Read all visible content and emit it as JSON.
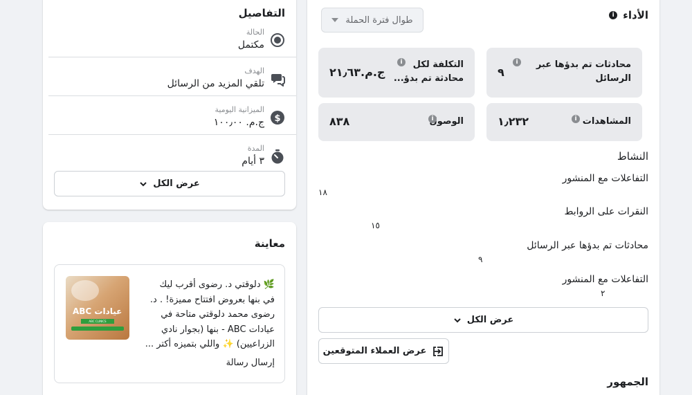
{
  "details": {
    "title": "التفاصيل",
    "rows": [
      {
        "label": "الحالة",
        "value": "مكتمل",
        "icon": "status-icon"
      },
      {
        "label": "الهدف",
        "value": "تلقي المزيد من الرسائل",
        "icon": "message-icon"
      },
      {
        "label": "الميزانية اليومية",
        "value": "ج.م. ١٠٠٫٠٠",
        "icon": "dollar-icon"
      },
      {
        "label": "المدة",
        "value": "٣ أيام",
        "icon": "stopwatch-icon"
      }
    ],
    "see_all": "عرض الكل"
  },
  "preview": {
    "title": "معاينة",
    "ad_text_line1": "🌿 دلوقتي د. رضوى أقرب ليك",
    "ad_text_line2": "في بنها بعروض افتتاح مميزة! . د.",
    "ad_text_line3": "رضوى محمد دلوقتي متاحة في",
    "ad_text_line4": "عيادات ABC - بنها (بجوار نادي",
    "ad_text_line5": "الزراعيين) ✨ واللي بتميزه أكتر ...",
    "cta": "إرسال رسالة",
    "thumb_brand": "عيادات ABC",
    "thumb_tag": "ABC CLINICS"
  },
  "performance": {
    "title": "الأداء",
    "period_dropdown": "طوال فترة الحملة",
    "metrics": [
      {
        "label_l1": "محادثات تم بدؤها عبر",
        "label_l2": "الرسائل",
        "value": "٩"
      },
      {
        "label_l1": "التكلفة لكل",
        "label_l2": "محادثة تم بدؤ...",
        "value": "ج.م.٢١٫٦٣"
      },
      {
        "label_l1": "المشاهدات",
        "label_l2": "",
        "value": "١٫٢٣٢"
      },
      {
        "label_l1": "الوصول",
        "label_l2": "",
        "value": "٨٣٨"
      }
    ],
    "activity_title": "النشاط",
    "activity": [
      {
        "label": "التفاعلات مع المنشور",
        "value": "١٨",
        "fraction": 1.0
      },
      {
        "label": "النقرات على الروابط",
        "value": "١٥",
        "fraction": 0.83
      },
      {
        "label": "محادثات تم بدؤها عبر الرسائل",
        "value": "٩",
        "fraction": 0.5
      },
      {
        "label": "التفاعلات مع المنشور",
        "value": "٢",
        "fraction": 0.11
      }
    ],
    "see_all": "عرض الكل",
    "potential_customers": "عرض العملاء المتوقعين",
    "audience_title": "الجمهور"
  },
  "colors": {
    "bg": "#f0f2f5",
    "card": "#ffffff",
    "metric_bg": "#e9eaed",
    "thumb": "#d9a066",
    "badge": "#2e9e3e"
  }
}
